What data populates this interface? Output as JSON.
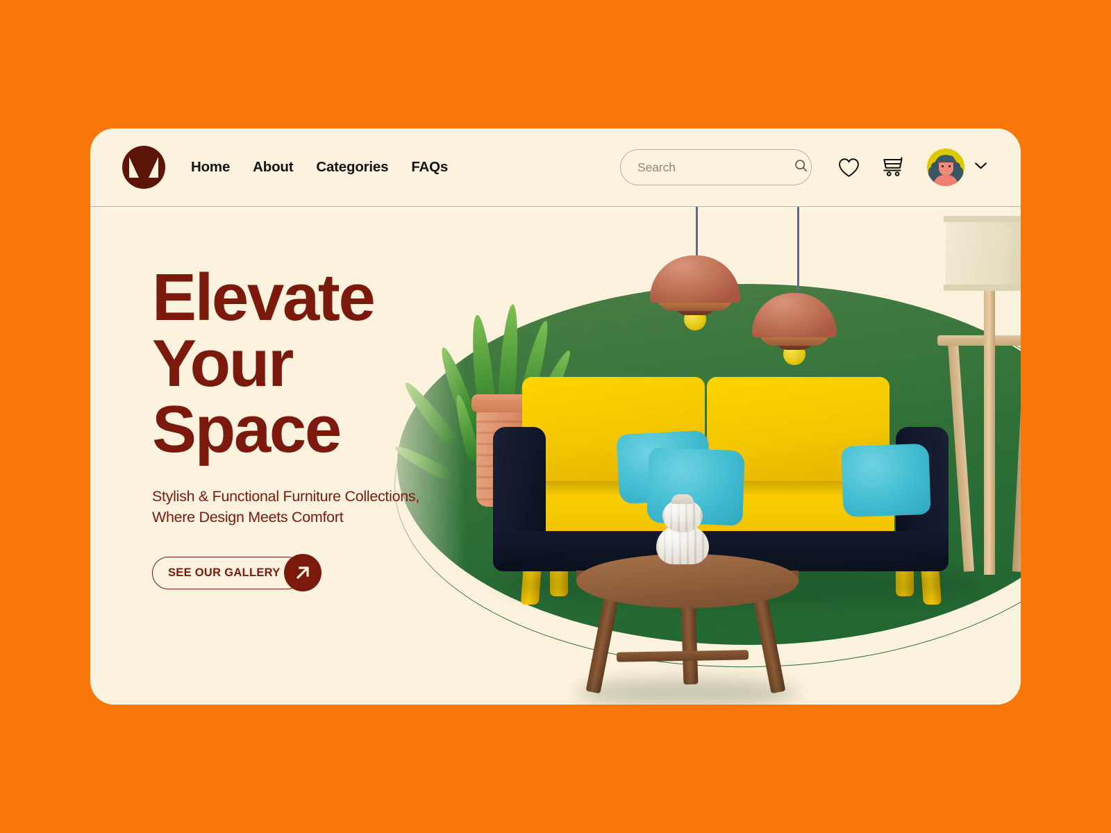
{
  "theme": {
    "page_background": "#f97608",
    "card_background": "#fcf2dd",
    "brand_maroon": "#7a190c",
    "logo_maroon": "#5d1408",
    "accent_green": "#2f7038",
    "sofa_yellow": "#fcd200",
    "pillow_teal": "#44bed2",
    "avatar_yellow": "#ddc800",
    "nav_text": "#141414"
  },
  "header": {
    "logo_name": "furniture-brand-logo",
    "nav": [
      {
        "label": "Home"
      },
      {
        "label": "About"
      },
      {
        "label": "Categories"
      },
      {
        "label": "FAQs"
      }
    ],
    "search": {
      "placeholder": "Search",
      "value": "",
      "icon": "search-icon"
    },
    "icons": [
      {
        "name": "heart-icon",
        "label": "Wishlist"
      },
      {
        "name": "cart-icon",
        "label": "Cart"
      }
    ],
    "account": {
      "avatar_name": "user-avatar",
      "chevron": "chevron-down-icon"
    }
  },
  "hero": {
    "headline_lines": [
      "Elevate",
      "Your",
      "Space"
    ],
    "subhead_lines": [
      "Stylish & Functional Furniture Collections,",
      "Where Design Meets Comfort"
    ],
    "cta": {
      "label": "SEE OUR GALLERY",
      "arrow_icon": "arrow-up-right-icon"
    }
  },
  "illustration": {
    "name": "living-room-3d-illustration",
    "objects": [
      "pendant-lamp-left",
      "pendant-lamp-right",
      "potted-plant",
      "yellow-sofa",
      "teal-pillow-left-front",
      "teal-pillow-left-back",
      "teal-pillow-right",
      "wooden-coffee-table",
      "ceramic-vase",
      "floor-lamp",
      "green-ellipse-backdrop"
    ]
  }
}
